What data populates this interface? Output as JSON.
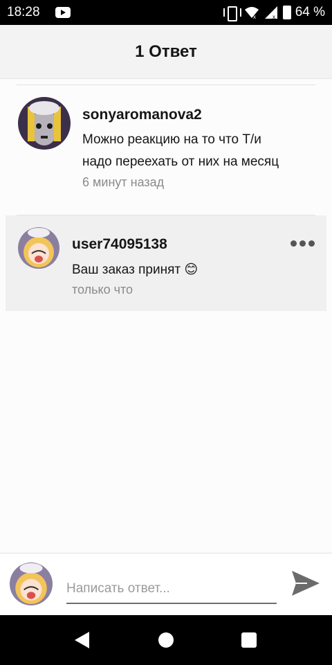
{
  "status_bar": {
    "time": "18:28",
    "battery_percent": "64 %",
    "icons": [
      "youtube-icon",
      "vibrate-icon",
      "wifi-icon",
      "signal-icon",
      "battery-icon"
    ]
  },
  "header": {
    "title": "1 Ответ"
  },
  "comment": {
    "username": "sonyaromanova2",
    "text_line1": "Можно реакцию на то что Т/и",
    "text_line2": "надо переехать от них на месяц",
    "time": "6 минут назад"
  },
  "reply": {
    "username": "user74095138",
    "text": "Ваш заказ принят 😊",
    "time": "только что",
    "more_icon": "more-dots-icon"
  },
  "composer": {
    "placeholder": "Написать ответ...",
    "value": "",
    "send_icon": "send-icon"
  },
  "nav_bar": {
    "icons": [
      "back-icon",
      "home-icon",
      "recents-icon"
    ]
  },
  "colors": {
    "header_bg": "#f4f3f4",
    "reply_highlight": "#f1f0f1",
    "secondary_text": "#8a8a8a"
  }
}
